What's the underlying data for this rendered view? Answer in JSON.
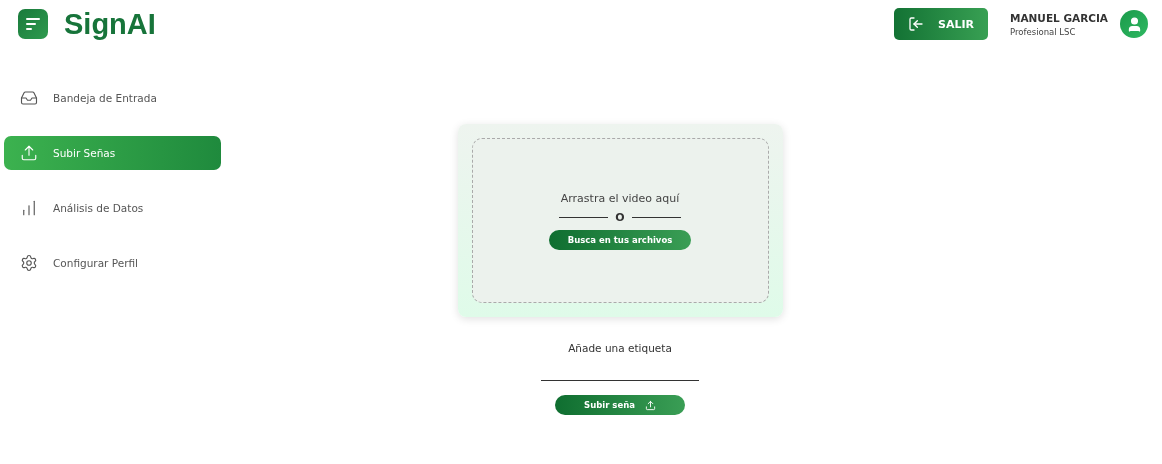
{
  "brand": {
    "name": "SignAI"
  },
  "header": {
    "logout_button": "SALIR",
    "user": {
      "name": "MANUEL GARCIA",
      "role": "Profesional LSC"
    }
  },
  "sidebar": {
    "items": [
      {
        "label": "Bandeja de Entrada",
        "selected": false
      },
      {
        "label": "Subir Señas",
        "selected": true
      },
      {
        "label": "Análisis de Datos",
        "selected": false
      },
      {
        "label": "Configurar Perfil",
        "selected": false
      }
    ]
  },
  "dropzone": {
    "prompt": "Arrastra el video aquí",
    "separator": "O",
    "browse_button": "Busca en tus archivos"
  },
  "tag_field": {
    "label": "Añade una etiqueta"
  },
  "submit_button": "Subir seña"
}
